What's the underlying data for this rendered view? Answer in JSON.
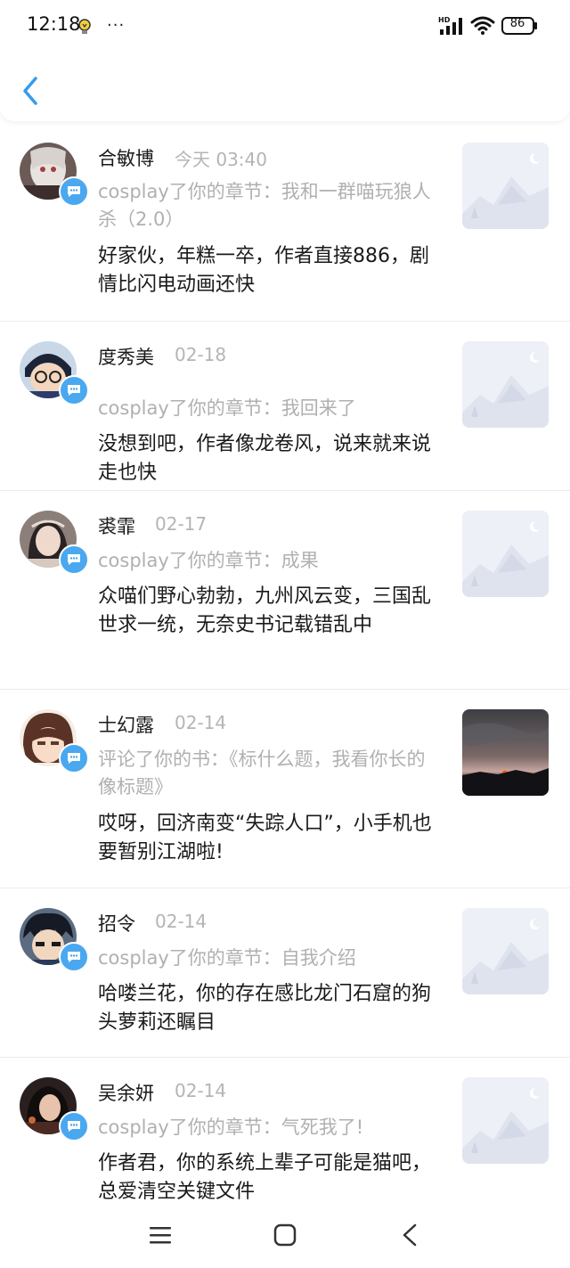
{
  "status_bar": {
    "time": "12:18",
    "more": "···",
    "hd": "HD",
    "battery": "86"
  },
  "header": {
    "back_icon": "back-chevron-icon"
  },
  "colors": {
    "accent": "#4aa8f0",
    "muted": "#b0b0b0",
    "text": "#1a1a1a"
  },
  "notifications": [
    {
      "name": "合敏博",
      "time": "今天 03:40",
      "action": "cosplay了你的章节：我和一群喵玩狼人杀（2.0）",
      "comment": "好家伙，年糕一卒，作者直接886，剧情比闪电动画还快",
      "thumb": "placeholder"
    },
    {
      "name": "度秀美",
      "time": "02-18",
      "action": "cosplay了你的章节：我回来了",
      "comment": "没想到吧，作者像龙卷风，说来就来说走也快",
      "thumb": "placeholder"
    },
    {
      "name": "裘霏",
      "time": "02-17",
      "action": "cosplay了你的章节：成果",
      "comment": "众喵们野心勃勃，九州风云变，三国乱世求一统，无奈史书记载错乱中",
      "thumb": "placeholder"
    },
    {
      "name": "士幻露",
      "time": "02-14",
      "action": "评论了你的书：《标什么题，我看你长的像标题》",
      "comment": "哎呀，回济南变“失踪人口”，小手机也要暂别江湖啦!",
      "thumb": "sunset"
    },
    {
      "name": "招令",
      "time": "02-14",
      "action": "cosplay了你的章节：自我介绍",
      "comment": "哈喽兰花，你的存在感比龙门石窟的狗头萝莉还瞩目",
      "thumb": "placeholder"
    },
    {
      "name": "吴余妍",
      "time": "02-14",
      "action": "cosplay了你的章节：气死我了!",
      "comment": "作者君，你的系统上辈子可能是猫吧，总爱清空关键文件",
      "thumb": "placeholder"
    }
  ]
}
